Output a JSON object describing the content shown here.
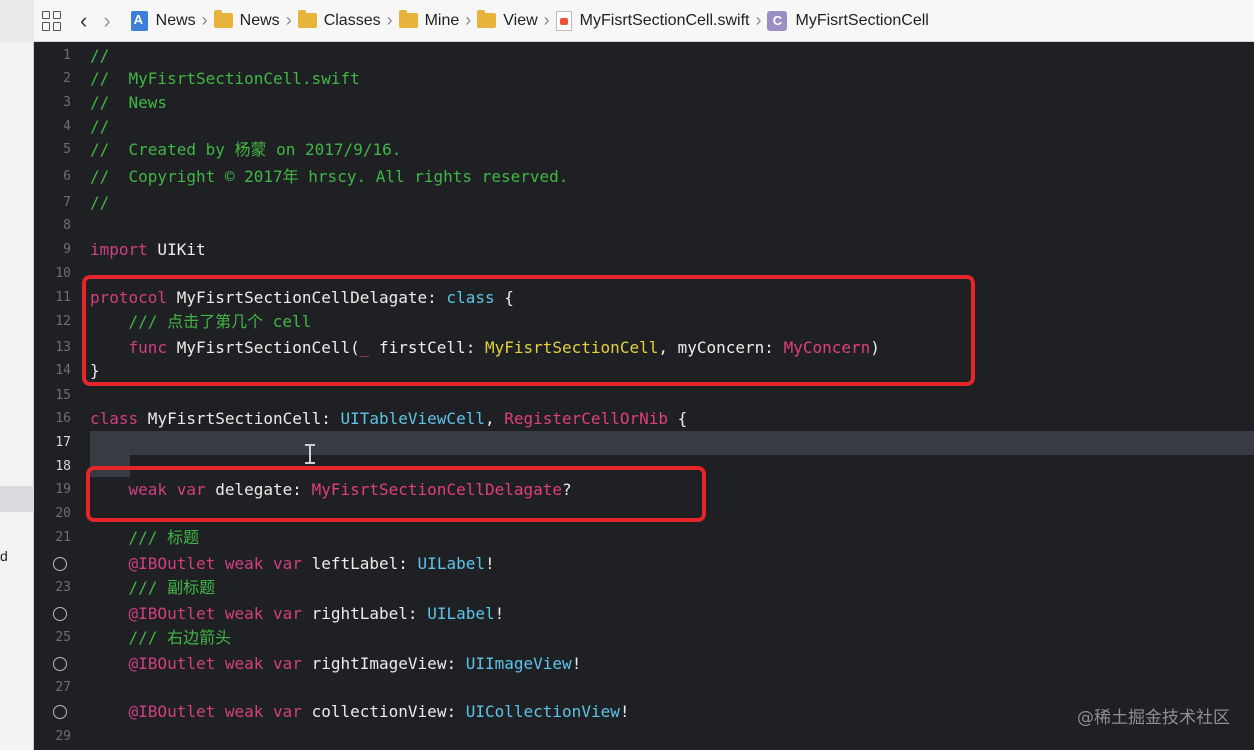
{
  "breadcrumbs": [
    {
      "label": "News",
      "icon": "project-icon"
    },
    {
      "label": "News",
      "icon": "folder-icon"
    },
    {
      "label": "Classes",
      "icon": "folder-icon"
    },
    {
      "label": "Mine",
      "icon": "folder-icon"
    },
    {
      "label": "View",
      "icon": "folder-icon"
    },
    {
      "label": "MyFisrtSectionCell.swift",
      "icon": "swift-file-icon"
    },
    {
      "label": "MyFisrtSectionCell",
      "icon": "class-icon"
    }
  ],
  "class_icon_letter": "C",
  "left_strip_letter": "d",
  "lines": [
    {
      "n": "1",
      "segs": [
        {
          "c": "c-comment",
          "t": "//"
        }
      ]
    },
    {
      "n": "2",
      "segs": [
        {
          "c": "c-comment",
          "t": "//  MyFisrtSectionCell.swift"
        }
      ]
    },
    {
      "n": "3",
      "segs": [
        {
          "c": "c-comment",
          "t": "//  News"
        }
      ]
    },
    {
      "n": "4",
      "segs": [
        {
          "c": "c-comment",
          "t": "//"
        }
      ]
    },
    {
      "n": "5",
      "segs": [
        {
          "c": "c-comment",
          "t": "//  Created by 杨蒙 on 2017/9/16."
        }
      ]
    },
    {
      "n": "6",
      "segs": [
        {
          "c": "c-comment",
          "t": "//  Copyright © 2017年 hrscy. All rights reserved."
        }
      ]
    },
    {
      "n": "7",
      "segs": [
        {
          "c": "c-comment",
          "t": "//"
        }
      ]
    },
    {
      "n": "8",
      "segs": []
    },
    {
      "n": "9",
      "segs": [
        {
          "c": "c-kw",
          "t": "import"
        },
        {
          "c": "c-plain",
          "t": " UIKit"
        }
      ]
    },
    {
      "n": "10",
      "segs": []
    },
    {
      "n": "11",
      "segs": [
        {
          "c": "c-kw",
          "t": "protocol"
        },
        {
          "c": "c-plain",
          "t": " MyFisrtSectionCellDelagate: "
        },
        {
          "c": "c-type",
          "t": "class"
        },
        {
          "c": "c-plain",
          "t": " {"
        }
      ]
    },
    {
      "n": "12",
      "segs": [
        {
          "c": "c-comment",
          "t": "    /// 点击了第几个 cell"
        }
      ]
    },
    {
      "n": "13",
      "segs": [
        {
          "c": "c-plain",
          "t": "    "
        },
        {
          "c": "c-kw",
          "t": "func"
        },
        {
          "c": "c-plain",
          "t": " MyFisrtSectionCell("
        },
        {
          "c": "c-kw",
          "t": "_"
        },
        {
          "c": "c-plain",
          "t": " firstCell: "
        },
        {
          "c": "c-yellow",
          "t": "MyFisrtSectionCell"
        },
        {
          "c": "c-plain",
          "t": ", myConcern: "
        },
        {
          "c": "c-pink",
          "t": "MyConcern"
        },
        {
          "c": "c-plain",
          "t": ")"
        }
      ]
    },
    {
      "n": "14",
      "segs": [
        {
          "c": "c-plain",
          "t": "}"
        }
      ]
    },
    {
      "n": "15",
      "segs": []
    },
    {
      "n": "16",
      "segs": [
        {
          "c": "c-kw",
          "t": "class"
        },
        {
          "c": "c-plain",
          "t": " MyFisrtSectionCell: "
        },
        {
          "c": "c-type",
          "t": "UITableViewCell"
        },
        {
          "c": "c-plain",
          "t": ", "
        },
        {
          "c": "c-pink",
          "t": "RegisterCellOrNib"
        },
        {
          "c": "c-plain",
          "t": " {"
        }
      ]
    },
    {
      "n": "17",
      "segs": [],
      "bright": true
    },
    {
      "n": "18",
      "segs": [],
      "bright": true
    },
    {
      "n": "19",
      "segs": [
        {
          "c": "c-plain",
          "t": "    "
        },
        {
          "c": "c-kw",
          "t": "weak"
        },
        {
          "c": "c-plain",
          "t": " "
        },
        {
          "c": "c-kw",
          "t": "var"
        },
        {
          "c": "c-plain",
          "t": " delegate: "
        },
        {
          "c": "c-pink",
          "t": "MyFisrtSectionCellDelagate"
        },
        {
          "c": "c-plain",
          "t": "?"
        }
      ]
    },
    {
      "n": "20",
      "segs": []
    },
    {
      "n": "21",
      "segs": [
        {
          "c": "c-comment",
          "t": "    /// 标题"
        }
      ]
    },
    {
      "n": "",
      "dot": true,
      "segs": [
        {
          "c": "c-plain",
          "t": "    "
        },
        {
          "c": "c-kw",
          "t": "@IBOutlet"
        },
        {
          "c": "c-plain",
          "t": " "
        },
        {
          "c": "c-kw",
          "t": "weak"
        },
        {
          "c": "c-plain",
          "t": " "
        },
        {
          "c": "c-kw",
          "t": "var"
        },
        {
          "c": "c-plain",
          "t": " leftLabel: "
        },
        {
          "c": "c-type",
          "t": "UILabel"
        },
        {
          "c": "c-plain",
          "t": "!"
        }
      ]
    },
    {
      "n": "23",
      "segs": [
        {
          "c": "c-comment",
          "t": "    /// 副标题"
        }
      ]
    },
    {
      "n": "",
      "dot": true,
      "segs": [
        {
          "c": "c-plain",
          "t": "    "
        },
        {
          "c": "c-kw",
          "t": "@IBOutlet"
        },
        {
          "c": "c-plain",
          "t": " "
        },
        {
          "c": "c-kw",
          "t": "weak"
        },
        {
          "c": "c-plain",
          "t": " "
        },
        {
          "c": "c-kw",
          "t": "var"
        },
        {
          "c": "c-plain",
          "t": " rightLabel: "
        },
        {
          "c": "c-type",
          "t": "UILabel"
        },
        {
          "c": "c-plain",
          "t": "!"
        }
      ]
    },
    {
      "n": "25",
      "segs": [
        {
          "c": "c-comment",
          "t": "    /// 右边箭头"
        }
      ]
    },
    {
      "n": "",
      "dot": true,
      "segs": [
        {
          "c": "c-plain",
          "t": "    "
        },
        {
          "c": "c-kw",
          "t": "@IBOutlet"
        },
        {
          "c": "c-plain",
          "t": " "
        },
        {
          "c": "c-kw",
          "t": "weak"
        },
        {
          "c": "c-plain",
          "t": " "
        },
        {
          "c": "c-kw",
          "t": "var"
        },
        {
          "c": "c-plain",
          "t": " rightImageView: "
        },
        {
          "c": "c-type",
          "t": "UIImageView"
        },
        {
          "c": "c-plain",
          "t": "!"
        }
      ]
    },
    {
      "n": "27",
      "segs": []
    },
    {
      "n": "",
      "dot": true,
      "segs": [
        {
          "c": "c-plain",
          "t": "    "
        },
        {
          "c": "c-kw",
          "t": "@IBOutlet"
        },
        {
          "c": "c-plain",
          "t": " "
        },
        {
          "c": "c-kw",
          "t": "weak"
        },
        {
          "c": "c-plain",
          "t": " "
        },
        {
          "c": "c-kw",
          "t": "var"
        },
        {
          "c": "c-plain",
          "t": " collectionView: "
        },
        {
          "c": "c-type",
          "t": "UICollectionView"
        },
        {
          "c": "c-plain",
          "t": "!"
        }
      ]
    },
    {
      "n": "29",
      "segs": []
    }
  ],
  "watermark": "@稀土掘金技术社区",
  "colors": {
    "comment": "#41b645",
    "keyword": "#d1407c",
    "type": "#5dc4e8",
    "project_type": "#e13e7d",
    "highlight_yellow": "#e5d13c",
    "annotation_red": "#e5252a",
    "editor_bg": "#1f2024"
  }
}
